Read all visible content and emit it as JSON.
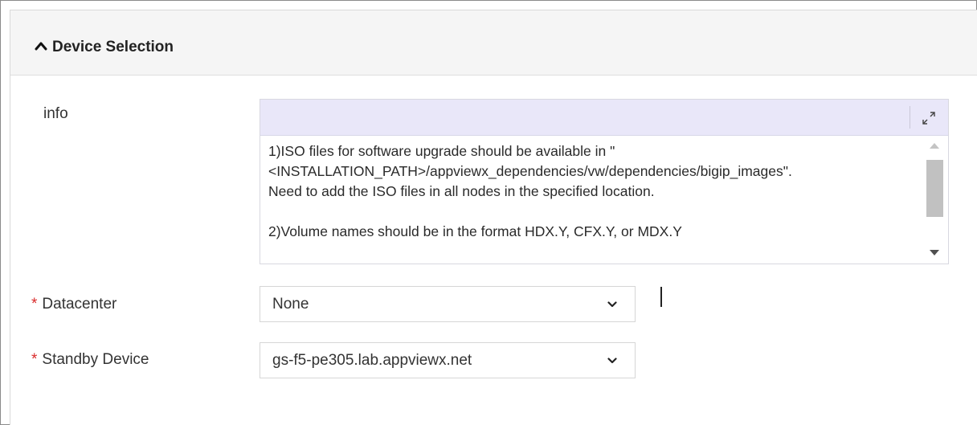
{
  "panel": {
    "title": "Device Selection",
    "collapse_icon": "chevron-up-icon"
  },
  "info": {
    "label": "info",
    "expand_icon": "expand-icon",
    "text": "1)ISO files for software upgrade should be available in \"\n<INSTALLATION_PATH>/appviewx_dependencies/vw/dependencies/bigip_images\".\nNeed to add the ISO files in all nodes in the specified location.\n\n2)Volume names should be in the format HDX.Y, CFX.Y, or MDX.Y"
  },
  "datacenter": {
    "required_mark": "*",
    "label": "Datacenter",
    "value": "None"
  },
  "standby_device": {
    "required_mark": "*",
    "label": "Standby Device",
    "value": "gs-f5-pe305.lab.appviewx.net"
  },
  "colors": {
    "required": "#d92b2b",
    "header_bg": "#f5f5f5",
    "toolbar_bg": "#e9e7f9"
  }
}
